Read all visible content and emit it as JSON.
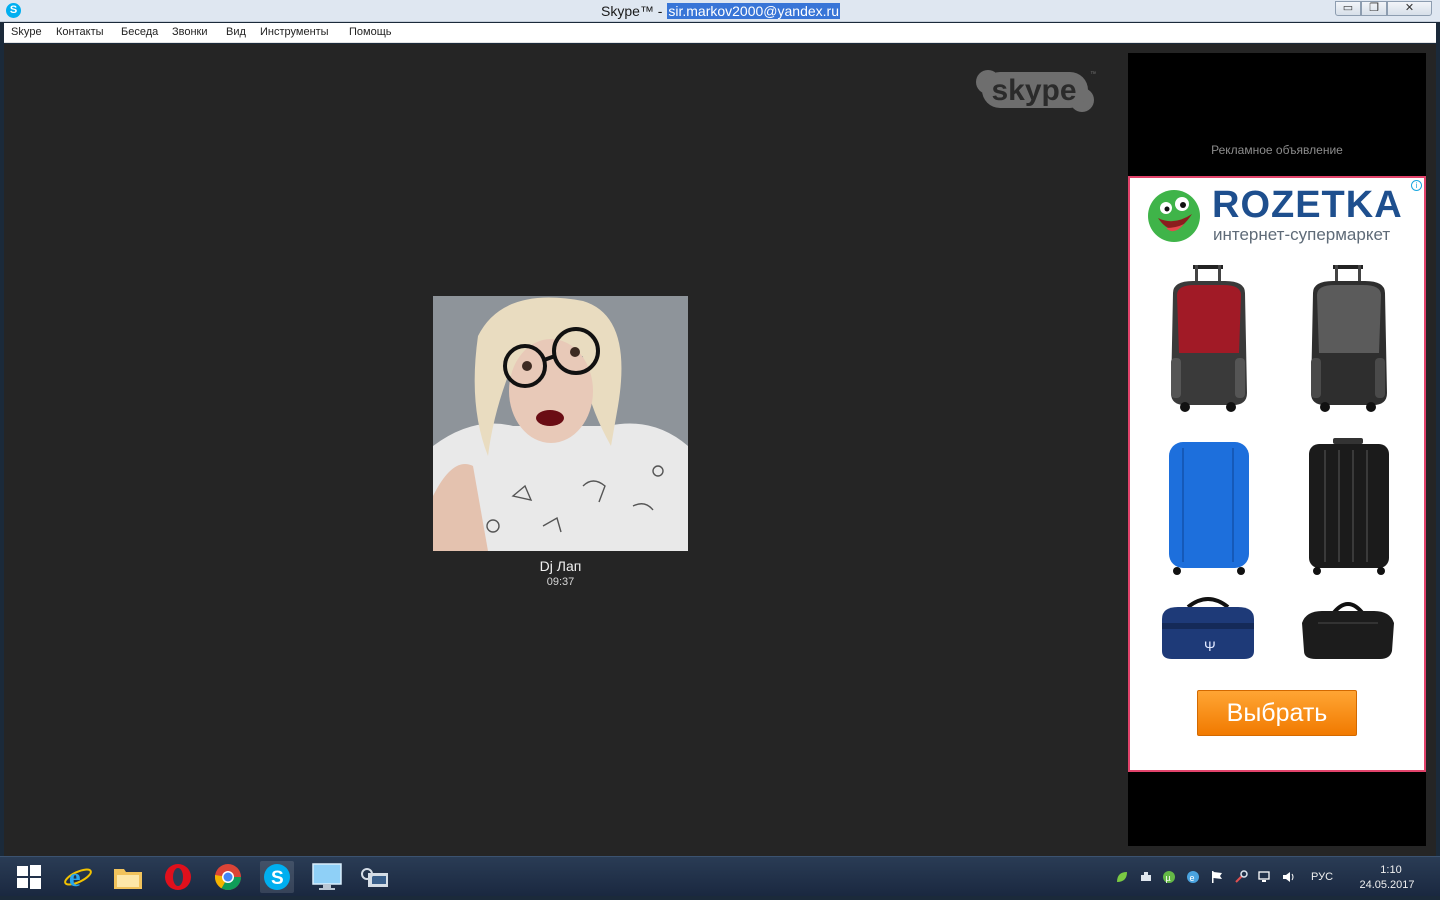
{
  "window": {
    "title_prefix": "Skype™ - ",
    "title_account": "sir.markov2000@yandex.ru",
    "minimize_glyph": "▭",
    "maximize_glyph": "❐",
    "close_glyph": "✕"
  },
  "menu": {
    "items": [
      "Skype",
      "Контакты",
      "Беседа",
      "Звонки",
      "Вид",
      "Инструменты",
      "Помощь"
    ]
  },
  "call": {
    "contact_name": "Dj Лап",
    "duration": "09:37"
  },
  "ad": {
    "label": "Рекламное объявление",
    "info_glyph": "i",
    "brand": "ROZETKA",
    "brand_subtitle": "интернет-супермаркет",
    "button_label": "Выбрать"
  },
  "taskbar": {
    "language": "РУС",
    "time": "1:10",
    "date": "24.05.2017"
  },
  "colors": {
    "skype_blue": "#00aff0",
    "ad_border": "#e2436b",
    "brand_blue": "#1e4f8e",
    "button_orange": "#f17a00"
  }
}
